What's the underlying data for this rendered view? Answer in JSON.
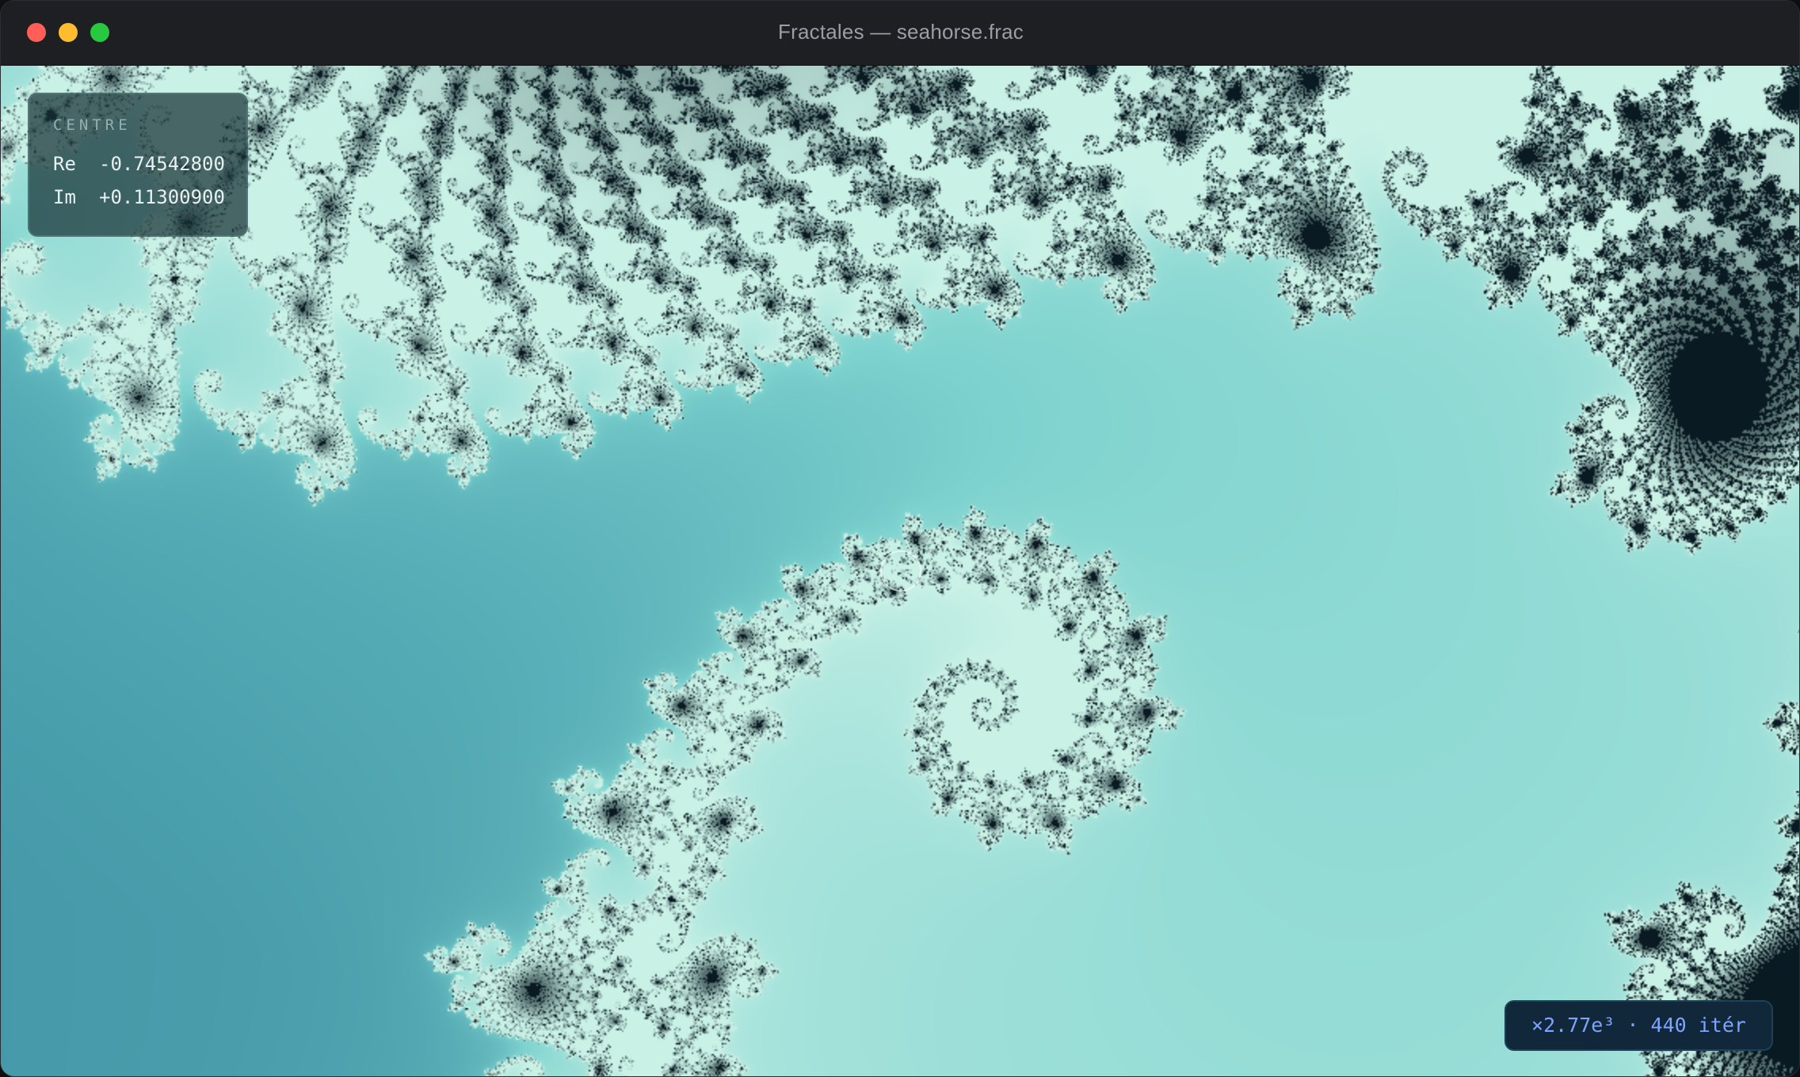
{
  "window": {
    "title": "Fractales — seahorse.frac"
  },
  "overlay": {
    "centre_label": "CENTRE",
    "re_label": "Re",
    "re_value": "-0.74542800",
    "im_label": "Im",
    "im_value": "+0.11300900"
  },
  "status": {
    "zoom_text": "×2.77e³ · 440 itér"
  },
  "colors": {
    "background_top": "#3a9fae",
    "background_bottom": "#1a6e8c",
    "filament": "#7fd3cf",
    "filament_light": "#c9f1e6",
    "core": "#0a1a22",
    "zoom_text": "#7fa3ff"
  }
}
